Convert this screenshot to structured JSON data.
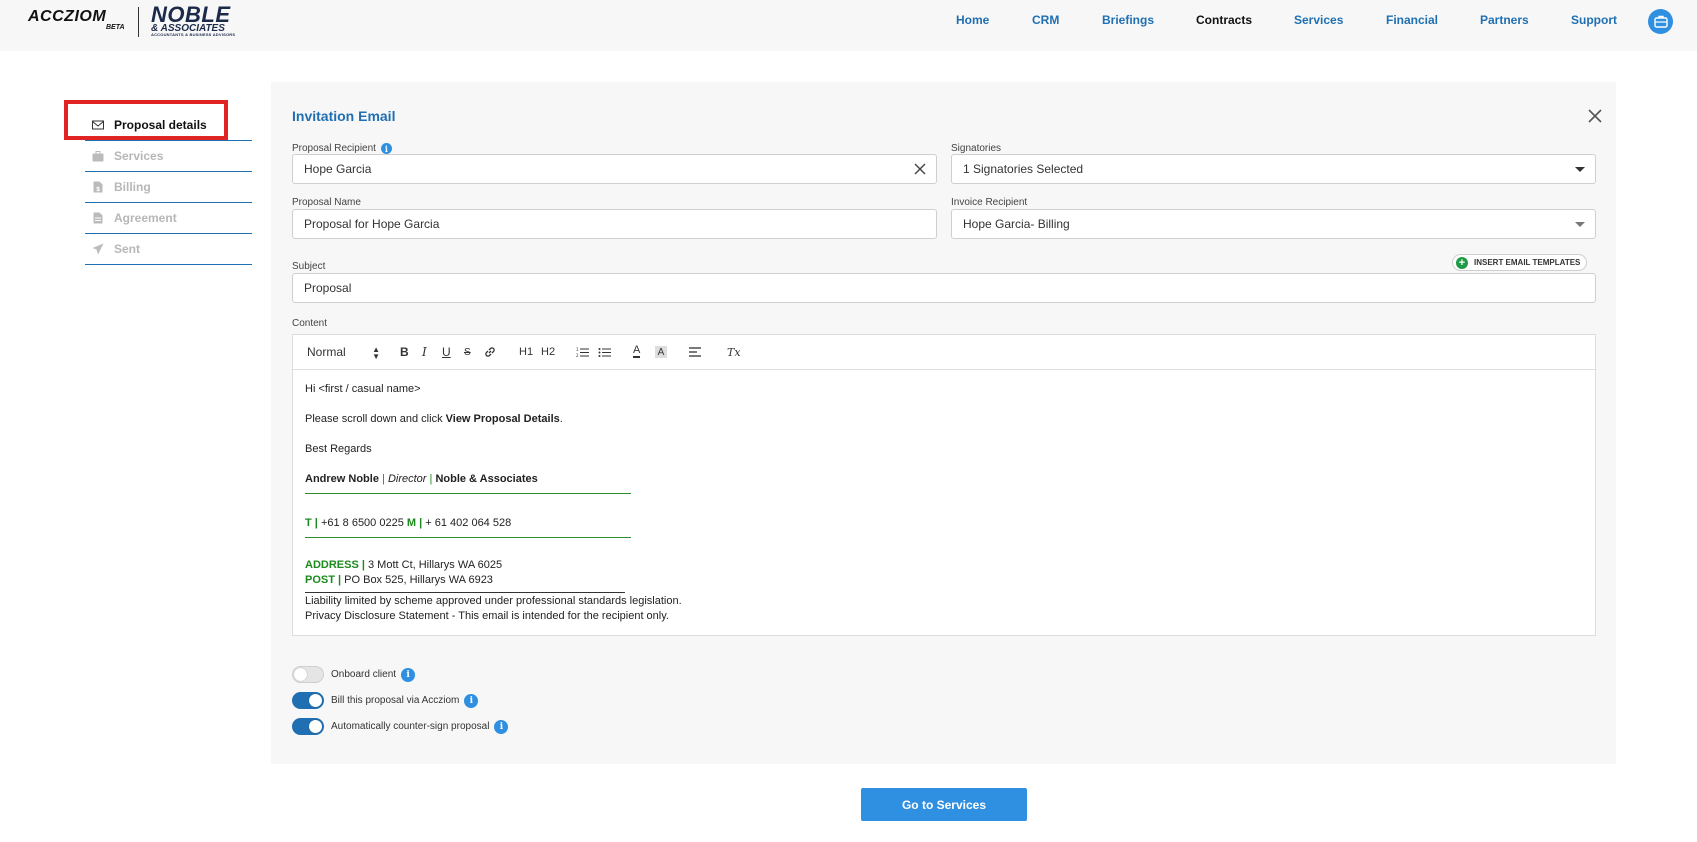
{
  "brand": {
    "app_name": "ACCZIOM",
    "app_badge": "BETA",
    "firm_line1": "NOBLE",
    "firm_line2": "& ASSOCIATES",
    "firm_tagline": "ACCOUNTANTS & BUSINESS ADVISORS"
  },
  "nav": {
    "items": [
      {
        "label": "Home",
        "active": false
      },
      {
        "label": "CRM",
        "active": false
      },
      {
        "label": "Briefings",
        "active": false
      },
      {
        "label": "Contracts",
        "active": true
      },
      {
        "label": "Services",
        "active": false
      },
      {
        "label": "Financial",
        "active": false
      },
      {
        "label": "Partners",
        "active": false
      },
      {
        "label": "Support",
        "active": false
      }
    ],
    "avatar_icon": "briefcase-icon"
  },
  "steps": [
    {
      "label": "Proposal details",
      "icon": "envelope-icon",
      "active": true
    },
    {
      "label": "Services",
      "icon": "briefcase-icon",
      "active": false
    },
    {
      "label": "Billing",
      "icon": "invoice-icon",
      "active": false
    },
    {
      "label": "Agreement",
      "icon": "document-icon",
      "active": false
    },
    {
      "label": "Sent",
      "icon": "paper-plane-icon",
      "active": false
    }
  ],
  "form": {
    "title": "Invitation Email",
    "recipient_label": "Proposal Recipient",
    "recipient_value": "Hope Garcia",
    "signatories_label": "Signatories",
    "signatories_value": "1 Signatories Selected",
    "proposal_name_label": "Proposal Name",
    "proposal_name_value": "Proposal for Hope Garcia",
    "invoice_recipient_label": "Invoice Recipient",
    "invoice_recipient_value": "Hope Garcia- Billing",
    "subject_label": "Subject",
    "subject_value": "Proposal",
    "insert_templates_label": "INSERT EMAIL TEMPLATES",
    "content_label": "Content"
  },
  "toolbar": {
    "format_value": "Normal",
    "bold": "B",
    "italic": "I",
    "underline": "U",
    "strike": "S",
    "h1": "H1",
    "h2": "H2",
    "text_color": "A",
    "bg_color": "A",
    "clear_format": "Tx"
  },
  "email": {
    "greeting": "Hi <first / casual name>",
    "instruction_pre": "Please scroll down and click ",
    "instruction_bold": "View Proposal Details",
    "instruction_post": ".",
    "closing": "Best Regards",
    "sig_name": "Andrew Noble",
    "sig_pipe": "|",
    "sig_title": "Director",
    "sig_firm": "Noble & Associates",
    "phone_t_label": "T",
    "phone_t": "+61 8 6500 0225",
    "phone_m_label": "M",
    "phone_m": "+ 61 402 064 528",
    "address_label": "ADDRESS",
    "address": "3 Mott Ct, Hillarys WA 6025",
    "post_label": "POST",
    "post": "PO Box 525, Hillarys WA 6923",
    "liability": "Liability limited by scheme approved under professional standards legislation.",
    "privacy": "Privacy Disclosure Statement - This email is intended for the recipient only."
  },
  "toggles": [
    {
      "label": "Onboard client",
      "on": false
    },
    {
      "label": "Bill this proposal via Accziom",
      "on": true
    },
    {
      "label": "Automatically counter-sign proposal",
      "on": true
    }
  ],
  "info_glyph": "i",
  "actions": {
    "next_label": "Go to Services"
  },
  "colors": {
    "primary": "#1f6fb2",
    "button": "#2f8fe0",
    "highlight": "#e02424",
    "signature_green": "#1c8a1c"
  }
}
